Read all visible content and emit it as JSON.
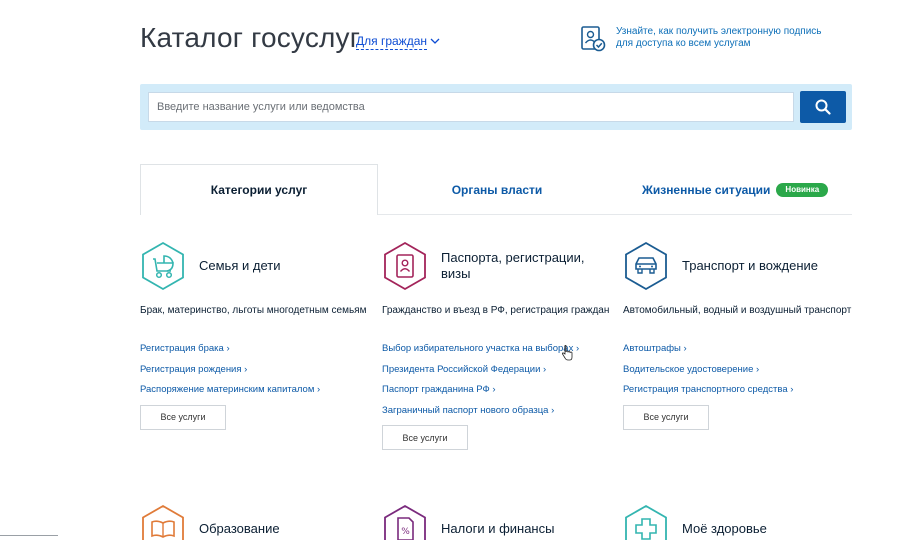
{
  "header": {
    "title": "Каталог госуслуг",
    "audience_label": "Для граждан",
    "promo_text": "Узнайте, как получить электронную подпись для доступа ко всем услугам"
  },
  "search": {
    "placeholder": "Введите название услуги или ведомства"
  },
  "tabs": [
    {
      "label": "Категории услуг",
      "active": true
    },
    {
      "label": "Органы власти",
      "active": false
    },
    {
      "label": "Жизненные ситуации",
      "active": false,
      "badge": "Новинка"
    }
  ],
  "categories": [
    {
      "title": "Семья и дети",
      "description": "Брак, материнство, льготы многодетным семьям",
      "links": [
        "Регистрация брака ›",
        "Регистрация рождения ›",
        "Распоряжение материнским капиталом ›"
      ],
      "all_label": "Все услуги",
      "icon": "stroller-icon",
      "color": "#33b5b0"
    },
    {
      "title": "Паспорта, регистрации, визы",
      "description": "Гражданство и въезд в РФ, регистрация граждан",
      "links": [
        "Выбор избирательного участка на выборах ›",
        "Президента Российской Федерации ›",
        "Паспорт гражданина РФ ›",
        "Заграничный паспорт нового образца ›"
      ],
      "all_label": "Все услуги",
      "icon": "passport-icon",
      "color": "#a3245a"
    },
    {
      "title": "Транспорт и вождение",
      "description": "Автомобильный, водный и воздушный транспорт",
      "links": [
        "Автоштрафы ›",
        "Водительское удостоверение ›",
        "Регистрация транспортного средства ›"
      ],
      "all_label": "Все услуги",
      "icon": "car-icon",
      "color": "#1b5c92"
    },
    {
      "title": "Образование",
      "icon": "book-icon",
      "color": "#e07b39"
    },
    {
      "title": "Налоги и финансы",
      "icon": "tax-document-icon",
      "color": "#7a2a7d"
    },
    {
      "title": "Моё здоровье",
      "icon": "medical-cross-icon",
      "color": "#33b5b0"
    }
  ]
}
